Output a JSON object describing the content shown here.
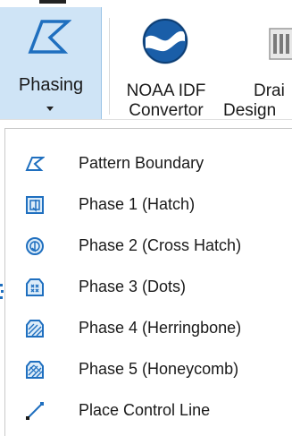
{
  "ribbon": {
    "phasing_label": "Phasing",
    "noaa_label_line1": "NOAA IDF",
    "noaa_label_line2": "Convertor",
    "drain_label_line1": "Drai",
    "drain_label_line2": "Design"
  },
  "menu": {
    "items": [
      {
        "label": "Pattern Boundary",
        "icon": "pattern-boundary-icon"
      },
      {
        "label": "Phase 1 (Hatch)",
        "icon": "phase-hatch-icon"
      },
      {
        "label": "Phase 2 (Cross Hatch)",
        "icon": "phase-cross-hatch-icon"
      },
      {
        "label": "Phase 3 (Dots)",
        "icon": "phase-dots-icon"
      },
      {
        "label": "Phase 4 (Herringbone)",
        "icon": "phase-herringbone-icon"
      },
      {
        "label": "Phase 5 (Honeycomb)",
        "icon": "phase-honeycomb-icon"
      },
      {
        "label": "Place Control Line",
        "icon": "control-line-icon"
      }
    ]
  },
  "colors": {
    "accent_blue": "#1f6fbf",
    "selected_bg": "#cfe4f6",
    "noaa_blue": "#1a5ea8"
  }
}
